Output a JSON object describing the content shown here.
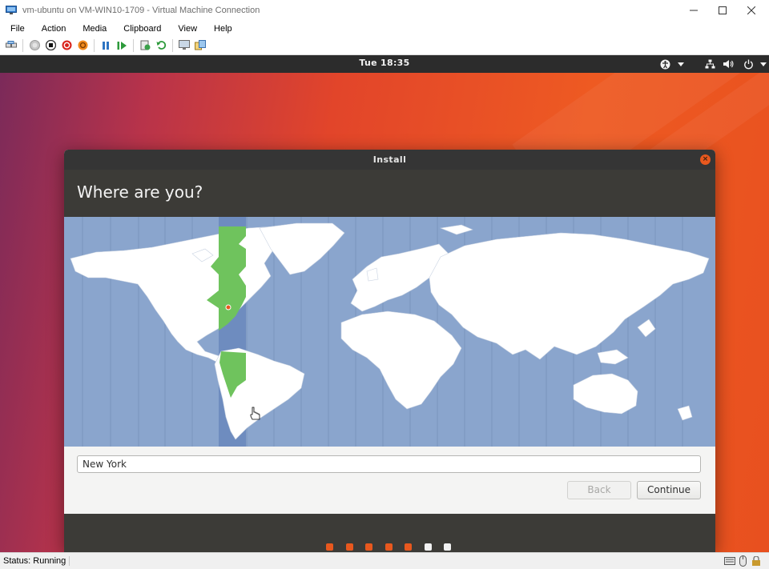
{
  "window": {
    "title": "vm-ubuntu on VM-WIN10-1709 - Virtual Machine Connection",
    "controls": [
      "minimize-icon",
      "maximize-icon",
      "close-icon"
    ]
  },
  "menubar": {
    "items": [
      "File",
      "Action",
      "Media",
      "Clipboard",
      "View",
      "Help"
    ]
  },
  "toolbar": {
    "icons": [
      "ctrl-alt-del-icon",
      "start-icon",
      "turn-off-icon",
      "shutdown-icon",
      "save-icon",
      "pause-icon",
      "reset-icon",
      "checkpoint-icon",
      "revert-icon",
      "enhanced-session-icon",
      "share-icon"
    ]
  },
  "ubuntu_panel": {
    "clock": "Tue 18:35",
    "icons": [
      "accessibility-icon",
      "network-icon",
      "volume-icon",
      "power-icon"
    ],
    "text_color": "#f2f2f2"
  },
  "install_dialog": {
    "title": "Install",
    "heading": "Where are you?",
    "timezone_value": "New York",
    "back_label": "Back",
    "continue_label": "Continue",
    "progress_total": 7,
    "progress_done": 5,
    "selected_city_marker": "city-marker",
    "colors": {
      "header": "#3c3b37",
      "accent": "#e8581e",
      "timezone_highlight": "#6fc35d",
      "ocean": "#8aa5cd",
      "land": "#ffffff"
    }
  },
  "statusbar": {
    "status": "Status: Running"
  }
}
